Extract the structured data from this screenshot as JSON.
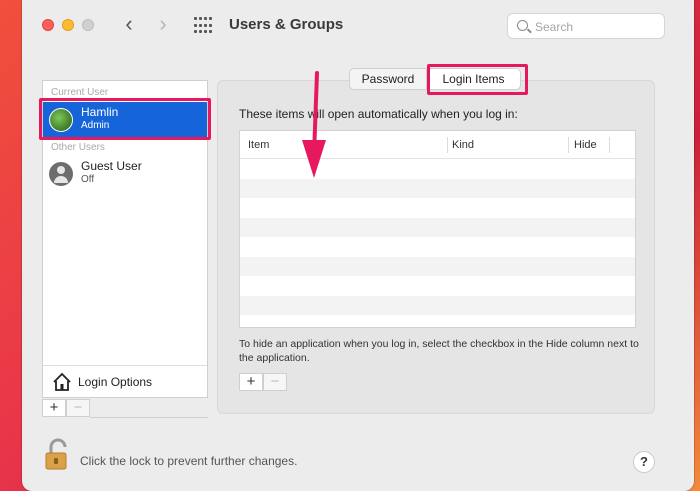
{
  "window": {
    "title": "Users & Groups",
    "search_placeholder": "Search",
    "nav": {
      "back_glyph": "‹",
      "forward_glyph": "›"
    }
  },
  "sidebar": {
    "current_user_heading": "Current User",
    "other_users_heading": "Other Users",
    "users": [
      {
        "name": "Hamlin",
        "role": "Admin",
        "selected": true
      },
      {
        "name": "Guest User",
        "role": "Off",
        "selected": false
      }
    ],
    "login_options_label": "Login Options",
    "add_glyph": "+",
    "remove_glyph": "−"
  },
  "tabs": [
    {
      "label": "Password",
      "active": false
    },
    {
      "label": "Login Items",
      "active": true
    }
  ],
  "login_items": {
    "description": "These items will open automatically when you log in:",
    "columns": [
      "Item",
      "Kind",
      "Hide"
    ],
    "rows": [],
    "footer_note": "To hide an application when you log in, select the checkbox in the Hide column next to the application.",
    "add_glyph": "+",
    "remove_glyph": "−"
  },
  "bottom": {
    "lock_text": "Click the lock to prevent further changes.",
    "help_glyph": "?"
  },
  "colors": {
    "selection_blue": "#1664d9",
    "annotation_pink": "#e7195e"
  },
  "icons": [
    "search-icon",
    "grid-icon",
    "house-icon",
    "lock-icon",
    "help-icon"
  ]
}
